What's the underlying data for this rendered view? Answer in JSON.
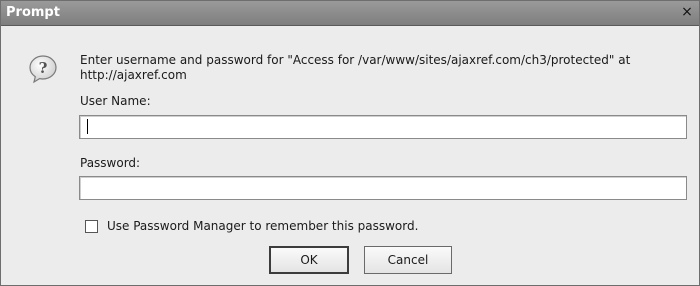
{
  "window": {
    "title": "Prompt",
    "close_glyph": "×"
  },
  "icon": {
    "name": "question-icon",
    "glyph": "?"
  },
  "message": {
    "line1": "Enter username and password for \"Access for /var/www/sites/ajaxref.com/ch3/protected\" at",
    "line2": "http://ajaxref.com"
  },
  "form": {
    "username_label": "User Name:",
    "username_value": "",
    "password_label": "Password:",
    "password_value": "",
    "remember_label": "Use Password Manager to remember this password.",
    "remember_checked": false
  },
  "buttons": {
    "ok_label": "OK",
    "cancel_label": "Cancel"
  }
}
